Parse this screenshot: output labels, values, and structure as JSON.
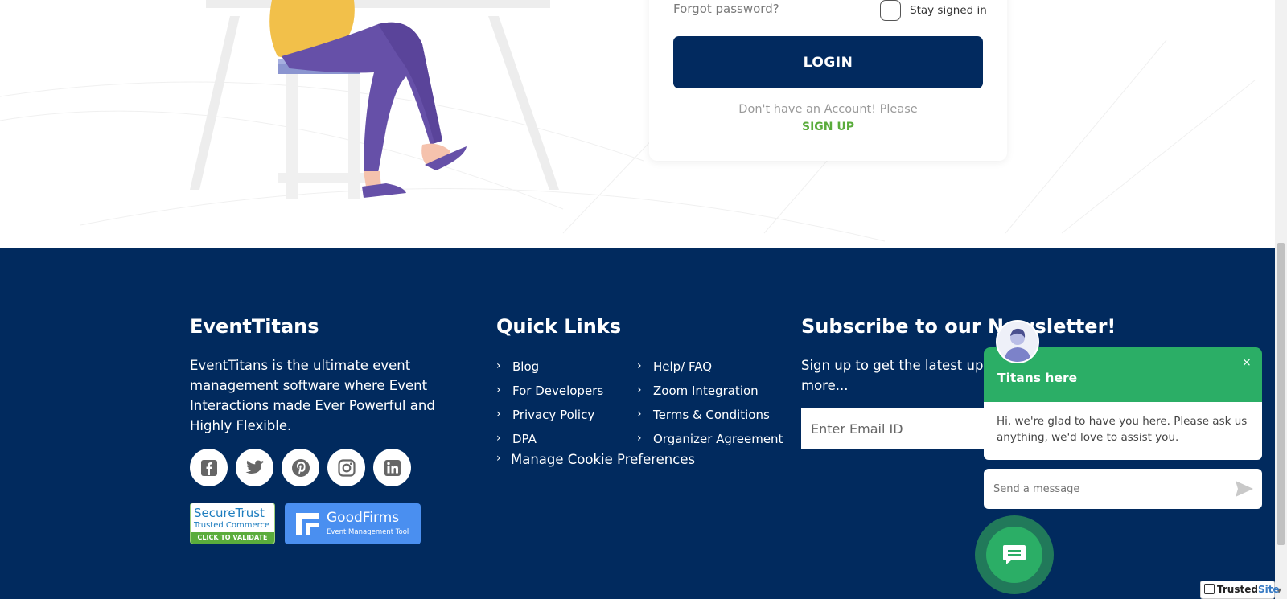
{
  "login": {
    "forgot_password": "Forgot password?",
    "stay_signed_in": "Stay signed in",
    "login_button": "LOGIN",
    "no_account": "Don't have an Account! Please",
    "signup": "SIGN UP"
  },
  "footer": {
    "brand_title": "EventTitans",
    "about_text": "EventTitans is the ultimate event management software where Event Interactions made Ever Powerful and Highly Flexible.",
    "social": [
      {
        "icon": "facebook-icon"
      },
      {
        "icon": "twitter-icon"
      },
      {
        "icon": "pinterest-icon"
      },
      {
        "icon": "instagram-icon"
      },
      {
        "icon": "linkedin-icon"
      }
    ],
    "securetrust": {
      "line1": "SecureTrust",
      "line2": "Trusted Commerce",
      "line3": "CLICK TO VALIDATE"
    },
    "goodfirms": {
      "name": "GoodFirms",
      "sub": "Event Management Tool"
    },
    "quick_links_title": "Quick Links",
    "quick_links": [
      "Blog",
      "Help/ FAQ",
      "For Developers",
      "Zoom Integration",
      "Privacy Policy",
      "Terms & Conditions",
      "DPA",
      "Organizer Agreement",
      "Manage Cookie Preferences"
    ],
    "newsletter_title": "Subscribe to our Newsletter!",
    "newsletter_desc": "Sign up to get the latest upd more...",
    "email_placeholder": "Enter Email ID"
  },
  "chat": {
    "title": "Titans here",
    "close": "×",
    "message": "Hi, we're glad to have you here. Please ask us anything, we'd love to assist you.",
    "input_placeholder": "Send a message"
  },
  "trusted_site": {
    "part1": "Trusted",
    "part2": "Site"
  },
  "colors": {
    "footer_bg": "#012a5e",
    "login_button": "#022a5f",
    "signup": "#5aac3c",
    "chat_green": "#2bae66"
  }
}
